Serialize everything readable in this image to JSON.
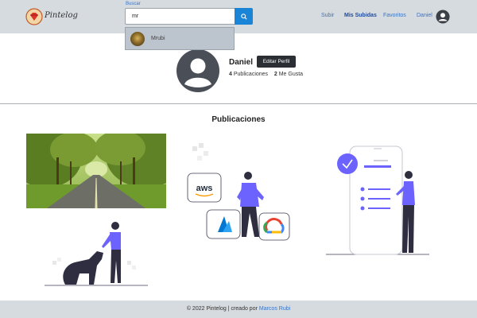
{
  "header": {
    "brand": "Pintelog",
    "search_label": "Buscar",
    "search_value": "mr",
    "nav": {
      "upload": "Subir",
      "my_uploads": "Mis Subidas",
      "favorites": "Favoritos",
      "user": "Daniel"
    }
  },
  "dropdown": {
    "items": [
      {
        "label": "Mrubi"
      }
    ]
  },
  "profile": {
    "name": "Daniel",
    "edit_label": "Editar Perfil",
    "posts_count": "4",
    "posts_label": "Publicaciones",
    "likes_count": "2",
    "likes_label": "Me Gusta"
  },
  "posts_section": {
    "title": "Publicaciones"
  },
  "post_images": {
    "cloud_labels": [
      "aws"
    ]
  },
  "footer": {
    "text": "© 2022 Pintelog | creado por",
    "author": "Marcos Rubi"
  },
  "colors": {
    "navbar_bg": "#d6dbdf",
    "link": "#3a73c4",
    "search_button": "#1a85d6",
    "edit_button": "#2b2f33",
    "accent_purple": "#6c63ff"
  }
}
